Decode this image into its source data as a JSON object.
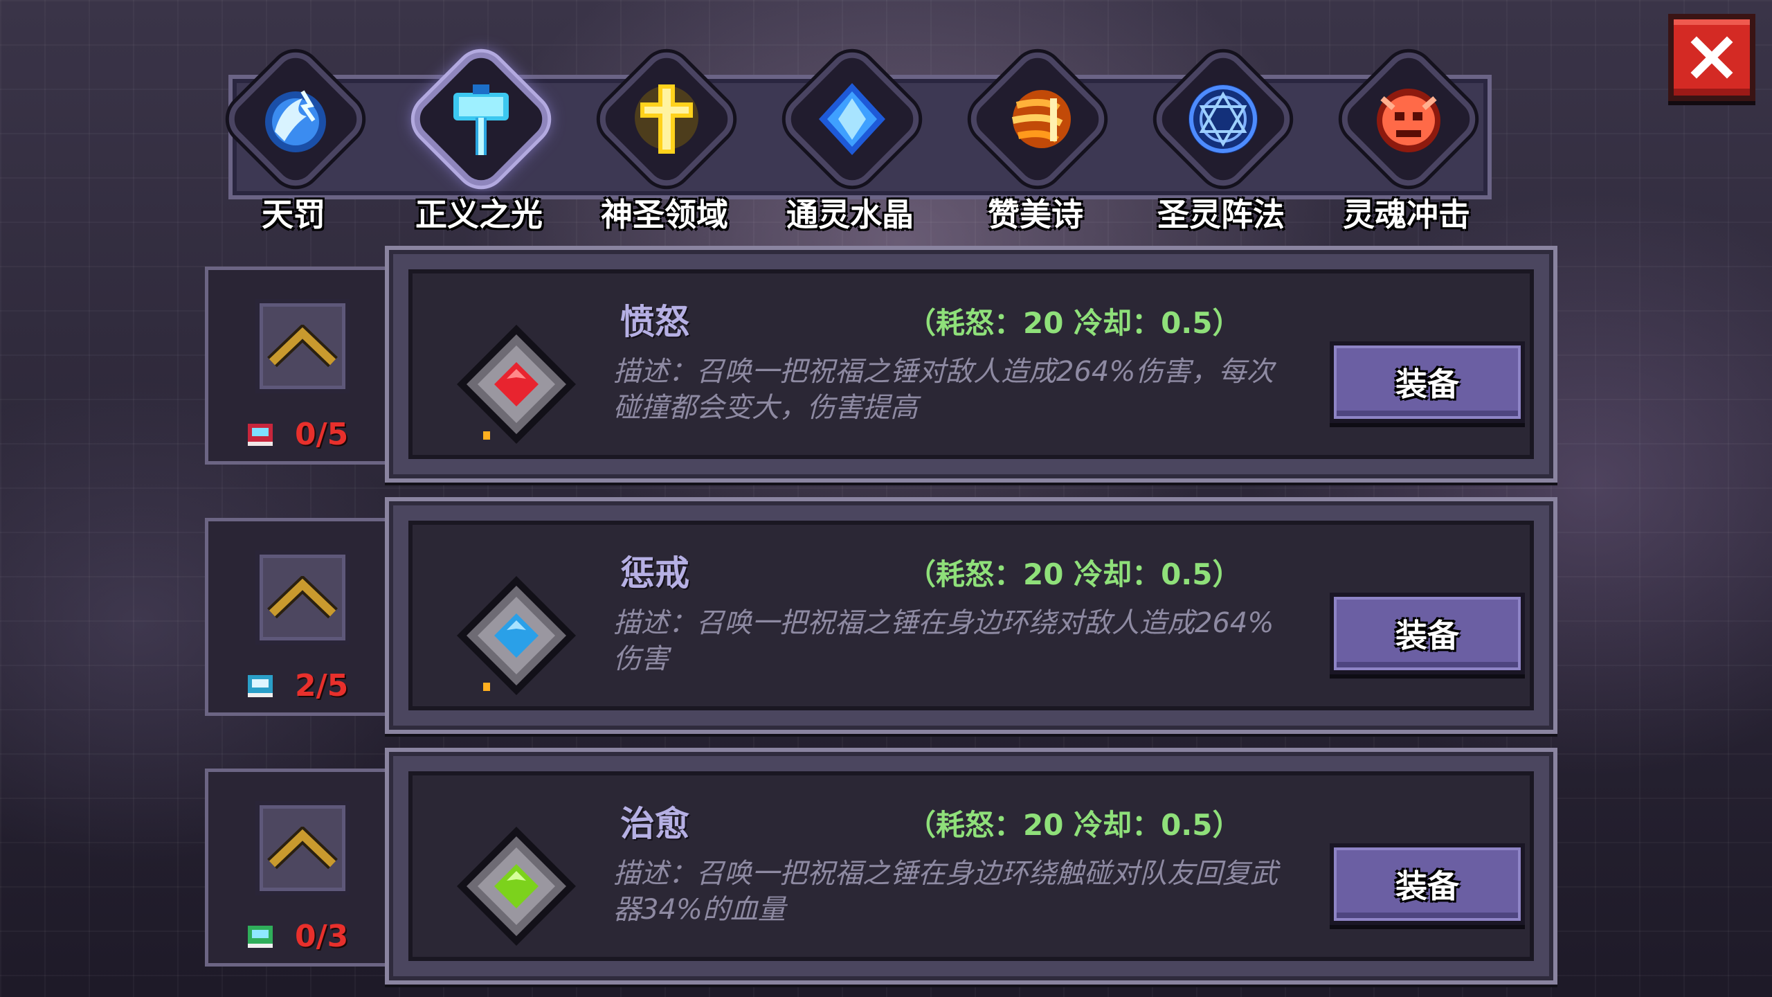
{
  "close_button": {
    "icon": "close-icon"
  },
  "tabs": [
    {
      "label": "天罚",
      "icon": "lightning-orb-icon",
      "color": "#4aa8ff",
      "active": false
    },
    {
      "label": "正义之光",
      "icon": "hammer-icon",
      "color": "#5fd8ff",
      "active": true
    },
    {
      "label": "神圣领域",
      "icon": "holy-cross-icon",
      "color": "#ffd21c",
      "active": false
    },
    {
      "label": "通灵水晶",
      "icon": "crystal-icon",
      "color": "#2f7dff",
      "active": false
    },
    {
      "label": "赞美诗",
      "icon": "hymn-flame-icon",
      "color": "#ff9a1c",
      "active": false
    },
    {
      "label": "圣灵阵法",
      "icon": "magic-circle-icon",
      "color": "#3d7bff",
      "active": false
    },
    {
      "label": "灵魂冲击",
      "icon": "demon-skull-icon",
      "color": "#ff5a3c",
      "active": false
    }
  ],
  "skills": [
    {
      "name": "愤怒",
      "stats": "（耗怒：20  冷却：0.5）",
      "description": "描述：召唤一把祝福之锤对敌人造成264%伤害，每次碰撞都会变大，伤害提高",
      "equip_label": "装备",
      "level": "0/5",
      "gem_color": "#e8242f",
      "book_color": "#c8263c"
    },
    {
      "name": "惩戒",
      "stats": "（耗怒：20  冷却：0.5）",
      "description": "描述：召唤一把祝福之锤在身边环绕对敌人造成264%伤害",
      "equip_label": "装备",
      "level": "2/5",
      "gem_color": "#2aa0e8",
      "book_color": "#2a9fc8"
    },
    {
      "name": "治愈",
      "stats": "（耗怒：20  冷却：0.5）",
      "description": "描述：召唤一把祝福之锤在身边环绕触碰对队友回复武器34%的血量",
      "equip_label": "装备",
      "level": "0/3",
      "gem_color": "#7cd21c",
      "book_color": "#2fae5a"
    }
  ]
}
